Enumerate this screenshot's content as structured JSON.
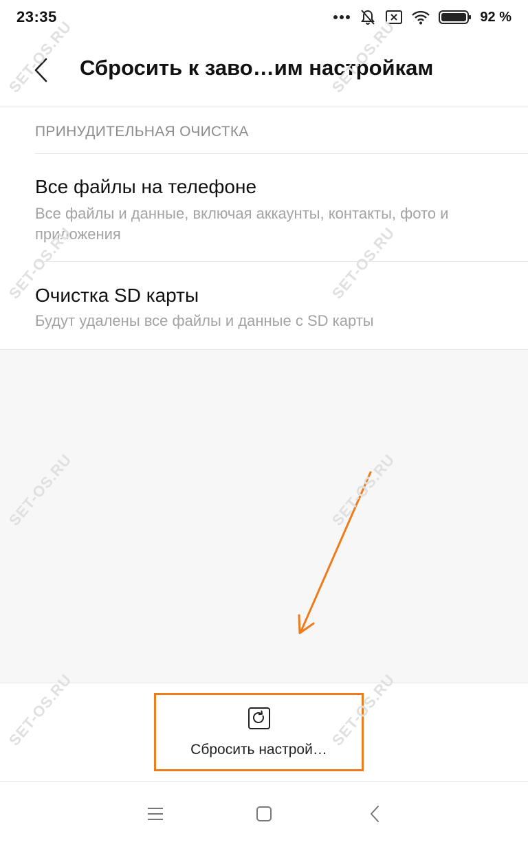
{
  "status_bar": {
    "time": "23:35",
    "battery_percent": "92 %",
    "icons": [
      "more-dots-icon",
      "muted-bell-icon",
      "no-sim-icon",
      "wifi-icon",
      "battery-icon"
    ]
  },
  "header": {
    "title": "Сбросить к заво…им настройкам",
    "back_icon": "chevron-left-icon"
  },
  "section": {
    "label": "ПРИНУДИТЕЛЬНАЯ ОЧИСТКА",
    "items": [
      {
        "title": "Все файлы на телефоне",
        "description": "Все файлы и данные, включая аккаунты, контакты, фото и приложения"
      },
      {
        "title": "Очистка SD карты",
        "description": "Будут удалены все файлы и данные с SD карты"
      }
    ]
  },
  "bottom_action": {
    "label": "Сбросить настрой…",
    "icon": "reset-icon",
    "highlight_color": "#f07b1b"
  },
  "nav_bar": {
    "icons": [
      "menu-icon",
      "home-icon",
      "back-icon"
    ]
  },
  "watermark": {
    "text": "SET-OS.RU"
  },
  "colors": {
    "accent_orange": "#f07b1b",
    "secondary_text": "#a3a3a3",
    "section_label": "#8c8c8c",
    "background_gray": "#f7f7f7"
  }
}
